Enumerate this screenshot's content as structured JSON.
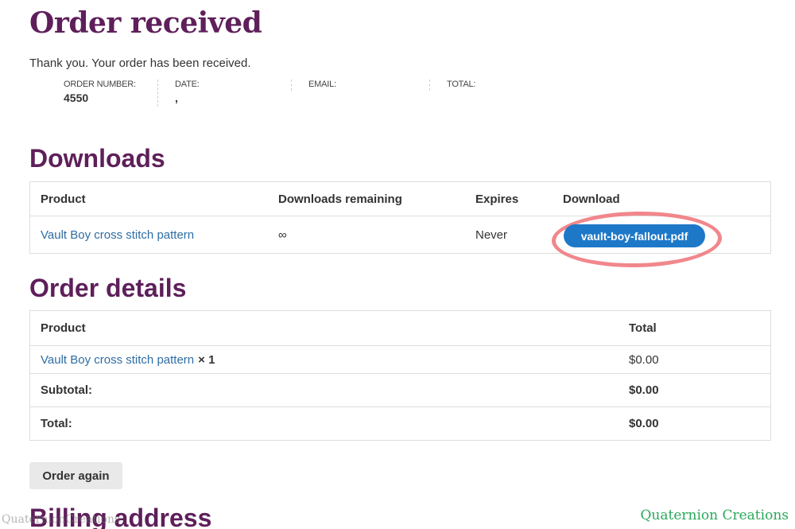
{
  "header": {
    "title": "Order received",
    "thank_you": "Thank you. Your order has been received."
  },
  "overview": {
    "order_number_label": "ORDER NUMBER:",
    "order_number": "4550",
    "date_label": "DATE:",
    "date": ",",
    "email_label": "EMAIL:",
    "total_label": "TOTAL:"
  },
  "downloads": {
    "title": "Downloads",
    "headers": [
      "Product",
      "Downloads remaining",
      "Expires",
      "Download"
    ],
    "rows": [
      {
        "product": "Vault Boy cross stitch pattern",
        "remaining": "∞",
        "expires": "Never",
        "file": "vault-boy-fallout.pdf"
      }
    ]
  },
  "order_details": {
    "title": "Order details",
    "headers": [
      "Product",
      "Total"
    ],
    "items": [
      {
        "product": "Vault Boy cross stitch pattern",
        "qty": "× 1",
        "total": "$0.00"
      }
    ],
    "subtotal_label": "Subtotal:",
    "subtotal": "$0.00",
    "total_label": "Total:",
    "total": "$0.00"
  },
  "order_again_label": "Order again",
  "billing_title": "Billing address",
  "watermark": {
    "left": "QuaternionCreations",
    "right": "Quaternion Creations"
  },
  "colors": {
    "heading": "#5e1f5a",
    "link": "#2e6da4",
    "button": "#1e78c8",
    "highlight": "#f07a80"
  }
}
